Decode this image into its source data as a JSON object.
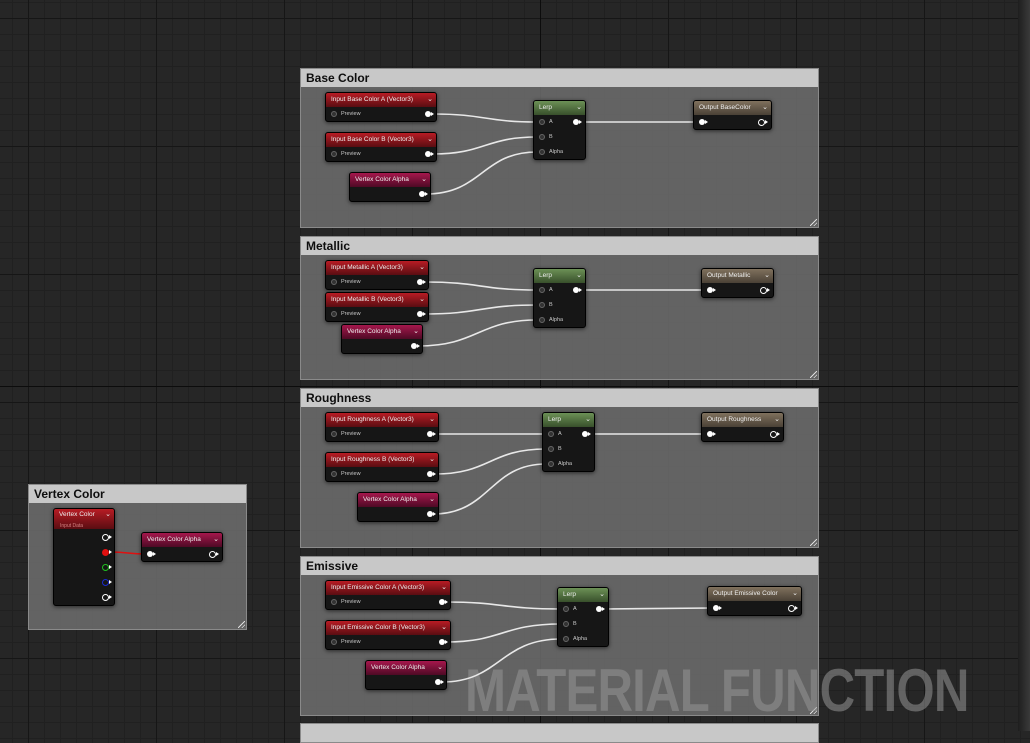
{
  "comments": {
    "base_color": "Base Color",
    "metallic": "Metallic",
    "roughness": "Roughness",
    "emissive": "Emissive",
    "vertex_color": "Vertex Color"
  },
  "nodes": {
    "input_base_a": "Input Base Color A (Vector3)",
    "input_base_b": "Input Base Color B (Vector3)",
    "input_metallic_a": "Input Metallic A (Vector3)",
    "input_metallic_b": "Input Metallic B (Vector3)",
    "input_roughness_a": "Input Roughness A (Vector3)",
    "input_roughness_b": "Input Roughness B (Vector3)",
    "input_emissive_a": "Input Emissive Color A (Vector3)",
    "input_emissive_b": "Input Emissive Color B (Vector3)",
    "vertex_color_alpha": "Vertex Color Alpha",
    "vertex_color": "Vertex Color",
    "vertex_color_sub": "Input Data",
    "lerp": "Lerp",
    "output_base": "Output BaseColor",
    "output_metallic": "Output Metallic",
    "output_roughness": "Output Roughness",
    "output_emissive": "Output Emissive Color"
  },
  "pins": {
    "preview": "Preview",
    "a": "A",
    "b": "B",
    "alpha": "Alpha"
  },
  "icons": {
    "dropdown": "chevron-down-icon",
    "chevron_glyph": "⌄"
  },
  "pin_colors": {
    "red": "#e01010",
    "green": "#20c020",
    "blue": "#1a2ad0"
  },
  "watermark": "MATERIAL FUNCTION"
}
